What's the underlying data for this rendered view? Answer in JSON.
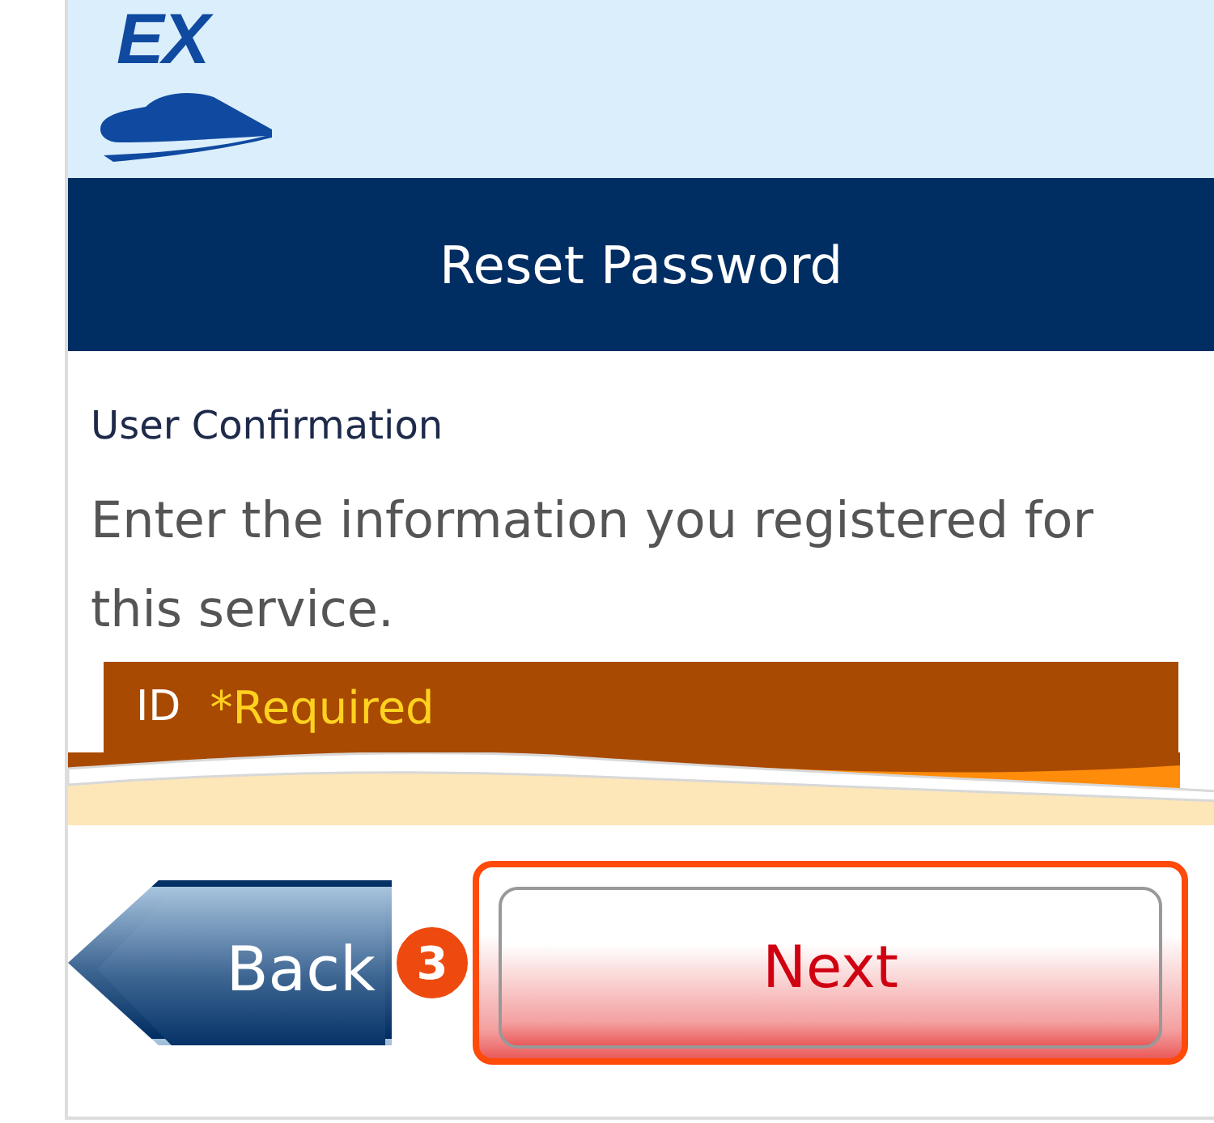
{
  "logo": {
    "text": "EX"
  },
  "header": {
    "title": "Reset Password"
  },
  "section": {
    "title": "User Confirmation",
    "instruction": "Enter the information you registered for this service."
  },
  "field": {
    "label": "ID",
    "note": "*Required"
  },
  "buttons": [
    {
      "kind": "back",
      "label": "Back",
      "highlighted": false
    },
    {
      "kind": "next",
      "label": "Next",
      "highlighted": true
    }
  ],
  "step_marker": {
    "number": "3"
  }
}
